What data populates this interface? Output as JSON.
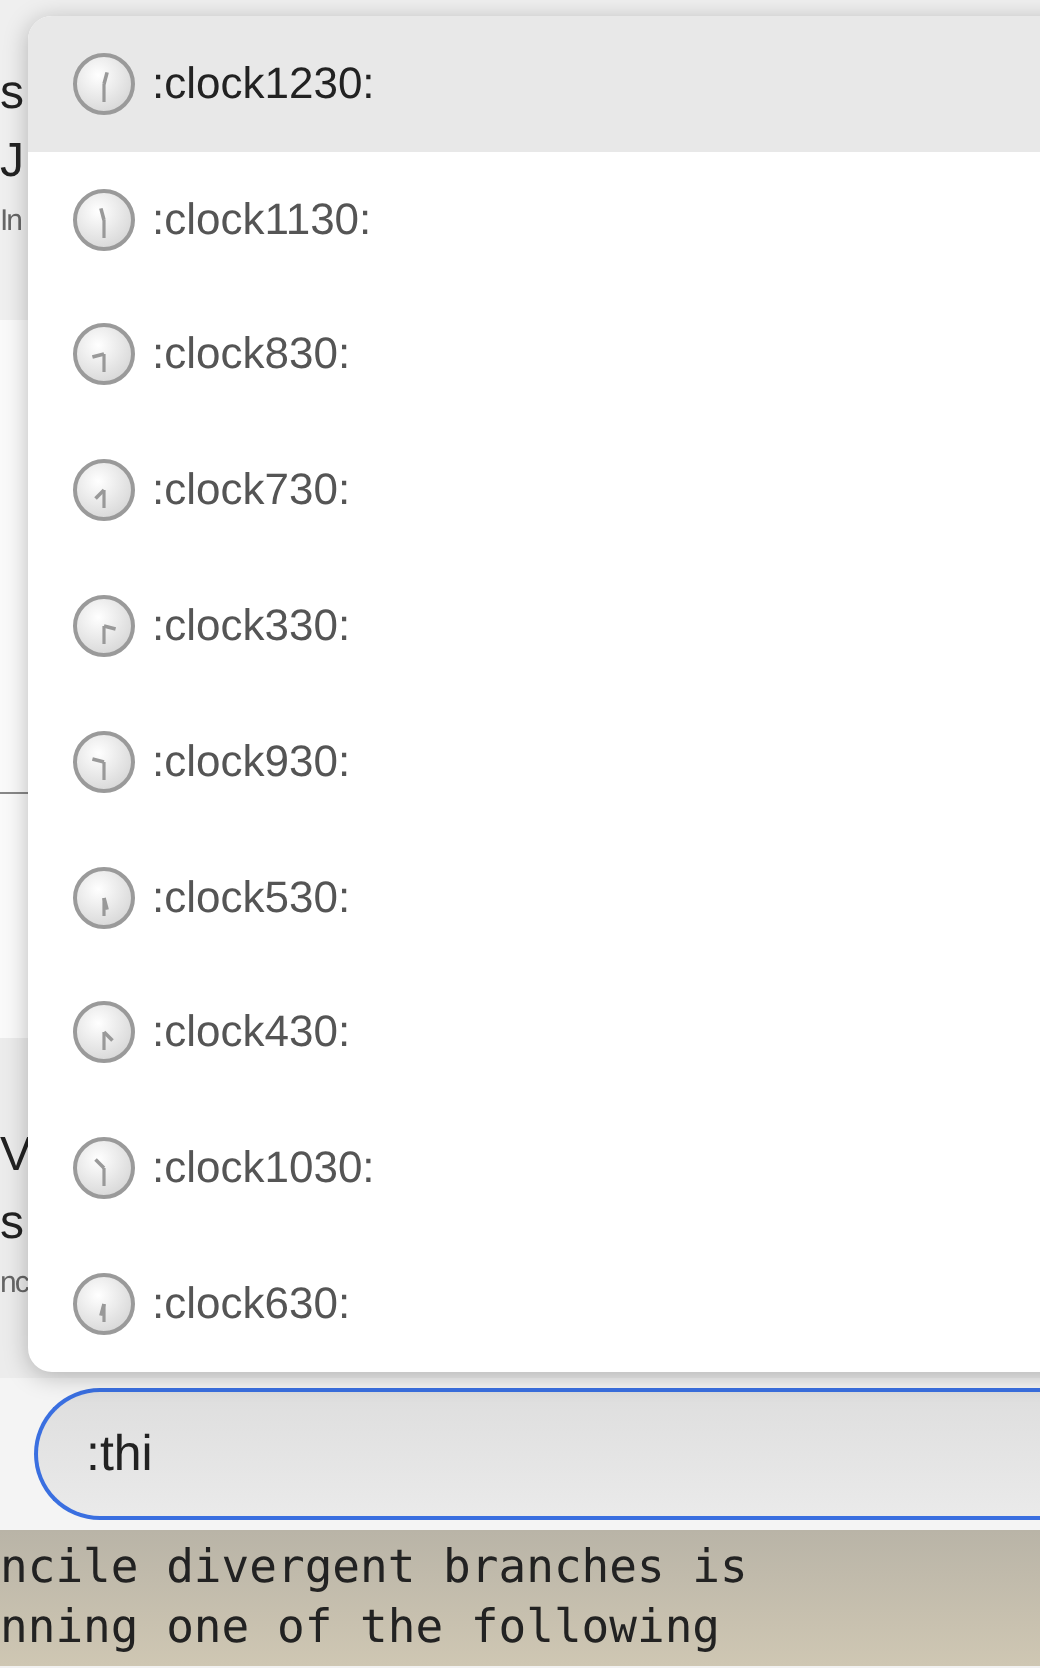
{
  "background": {
    "upper_fragments": [
      {
        "text": "s",
        "kind": "large"
      },
      {
        "text": "J",
        "kind": "large"
      },
      {
        "text": "In",
        "kind": "small"
      }
    ],
    "lower_fragments": [
      {
        "text": "V",
        "kind": "large"
      },
      {
        "text": "s",
        "kind": "large"
      },
      {
        "text": "nc",
        "kind": "small"
      }
    ],
    "document_lines": [
      "ncile divergent branches is",
      "nning one of the following"
    ]
  },
  "suggestions": [
    {
      "label": ":clock1230:",
      "selected": true
    },
    {
      "label": ":clock1130:",
      "selected": false
    },
    {
      "label": ":clock830:",
      "selected": false
    },
    {
      "label": ":clock730:",
      "selected": false
    },
    {
      "label": ":clock330:",
      "selected": false
    },
    {
      "label": ":clock930:",
      "selected": false
    },
    {
      "label": ":clock530:",
      "selected": false
    },
    {
      "label": ":clock430:",
      "selected": false
    },
    {
      "label": ":clock1030:",
      "selected": false
    },
    {
      "label": ":clock630:",
      "selected": false
    }
  ],
  "message_input": {
    "value": ":thi"
  }
}
